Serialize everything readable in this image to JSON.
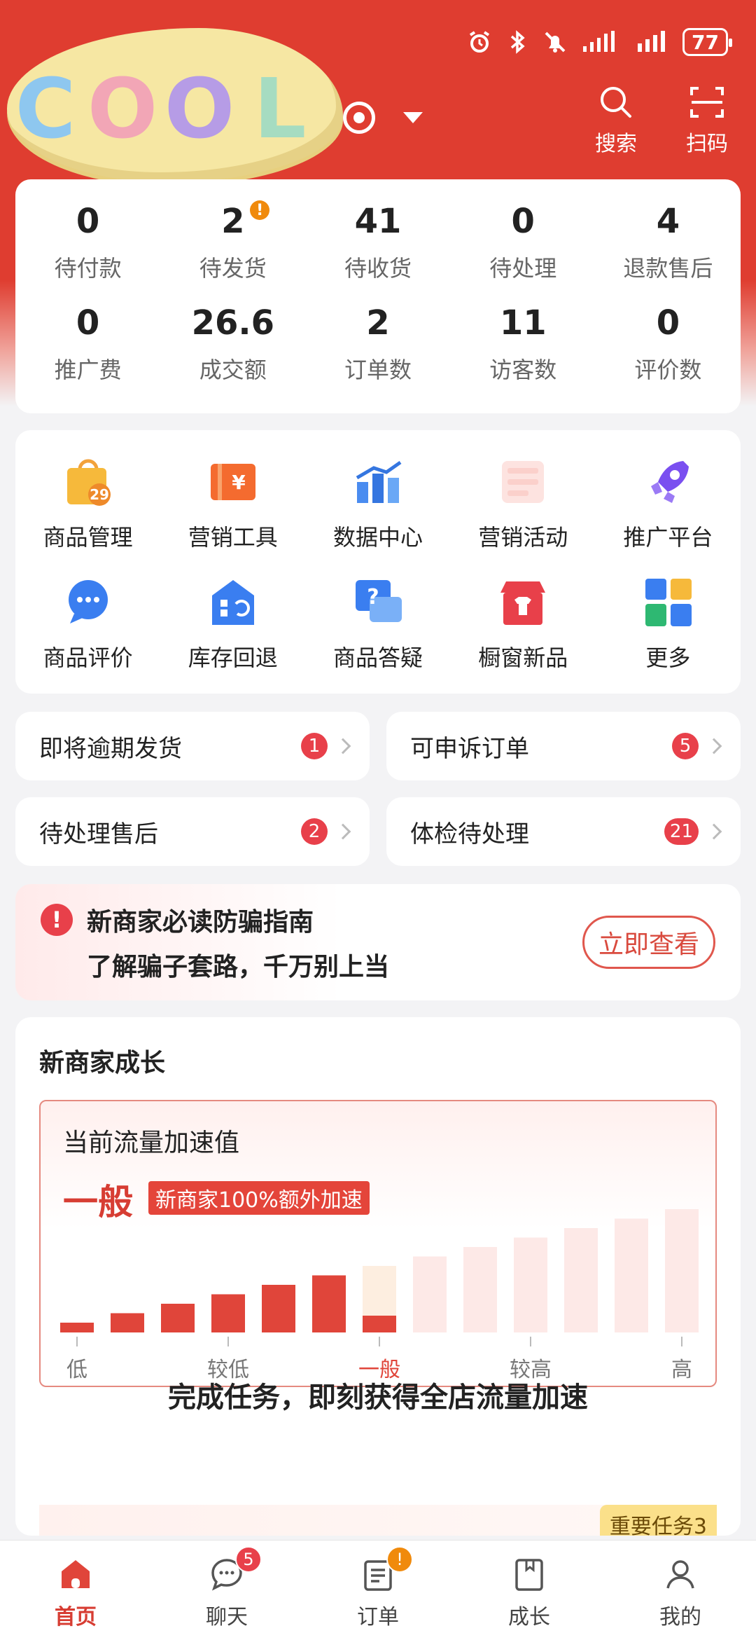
{
  "status_bar": {
    "battery": "77"
  },
  "header": {
    "logo_text": "COOL",
    "actions": [
      {
        "label": "搜索",
        "icon": "search-icon"
      },
      {
        "label": "扫码",
        "icon": "scan-icon"
      }
    ]
  },
  "stats": {
    "row1": [
      {
        "value": "0",
        "label": "待付款"
      },
      {
        "value": "2",
        "label": "待发货",
        "alert": "!"
      },
      {
        "value": "41",
        "label": "待收货"
      },
      {
        "value": "0",
        "label": "待处理"
      },
      {
        "value": "4",
        "label": "退款售后"
      }
    ],
    "row2": [
      {
        "value": "0",
        "label": "推广费"
      },
      {
        "value": "26.6",
        "label": "成交额"
      },
      {
        "value": "2",
        "label": "订单数"
      },
      {
        "value": "11",
        "label": "访客数"
      },
      {
        "value": "0",
        "label": "评价数"
      }
    ]
  },
  "tools": {
    "row1": [
      {
        "label": "商品管理",
        "icon": "shopping-bag-icon",
        "badge": "29"
      },
      {
        "label": "营销工具",
        "icon": "coupon-icon"
      },
      {
        "label": "数据中心",
        "icon": "bar-chart-icon"
      },
      {
        "label": "营销活动",
        "icon": "activity-icon"
      },
      {
        "label": "推广平台",
        "icon": "rocket-icon"
      }
    ],
    "row2": [
      {
        "label": "商品评价",
        "icon": "chat-bubble-icon"
      },
      {
        "label": "库存回退",
        "icon": "warehouse-return-icon"
      },
      {
        "label": "商品答疑",
        "icon": "question-bubble-icon"
      },
      {
        "label": "橱窗新品",
        "icon": "shop-window-icon"
      },
      {
        "label": "更多",
        "icon": "more-apps-icon"
      }
    ]
  },
  "quick": [
    {
      "label": "即将逾期发货",
      "count": "1"
    },
    {
      "label": "可申诉订单",
      "count": "5"
    },
    {
      "label": "待处理售后",
      "count": "2"
    },
    {
      "label": "体检待处理",
      "count": "21"
    }
  ],
  "warning": {
    "title": "新商家必读防骗指南",
    "subtitle": "了解骗子套路，千万别上当",
    "button": "立即查看"
  },
  "growth": {
    "title": "新商家成长",
    "boost_title": "当前流量加速值",
    "level": "一般",
    "tag": "新商家100%额外加速",
    "axis": [
      "低",
      "较低",
      "一般",
      "较高",
      "高"
    ],
    "slogan": "完成任务，即刻获得全店流量加速",
    "task_tag": "重要任务3",
    "accent": "#e0453a"
  },
  "chart_data": {
    "type": "bar",
    "x_labels": [
      "低",
      "较低",
      "一般",
      "较高",
      "高"
    ],
    "current_level": "一般",
    "bars_filled": 6,
    "bars_total": 13
  },
  "bottom_nav": [
    {
      "label": "首页",
      "icon": "home-icon",
      "active": true
    },
    {
      "label": "聊天",
      "icon": "chat-icon",
      "badge": "5"
    },
    {
      "label": "订单",
      "icon": "order-icon",
      "badge": "!"
    },
    {
      "label": "成长",
      "icon": "growth-book-icon"
    },
    {
      "label": "我的",
      "icon": "profile-icon"
    }
  ]
}
